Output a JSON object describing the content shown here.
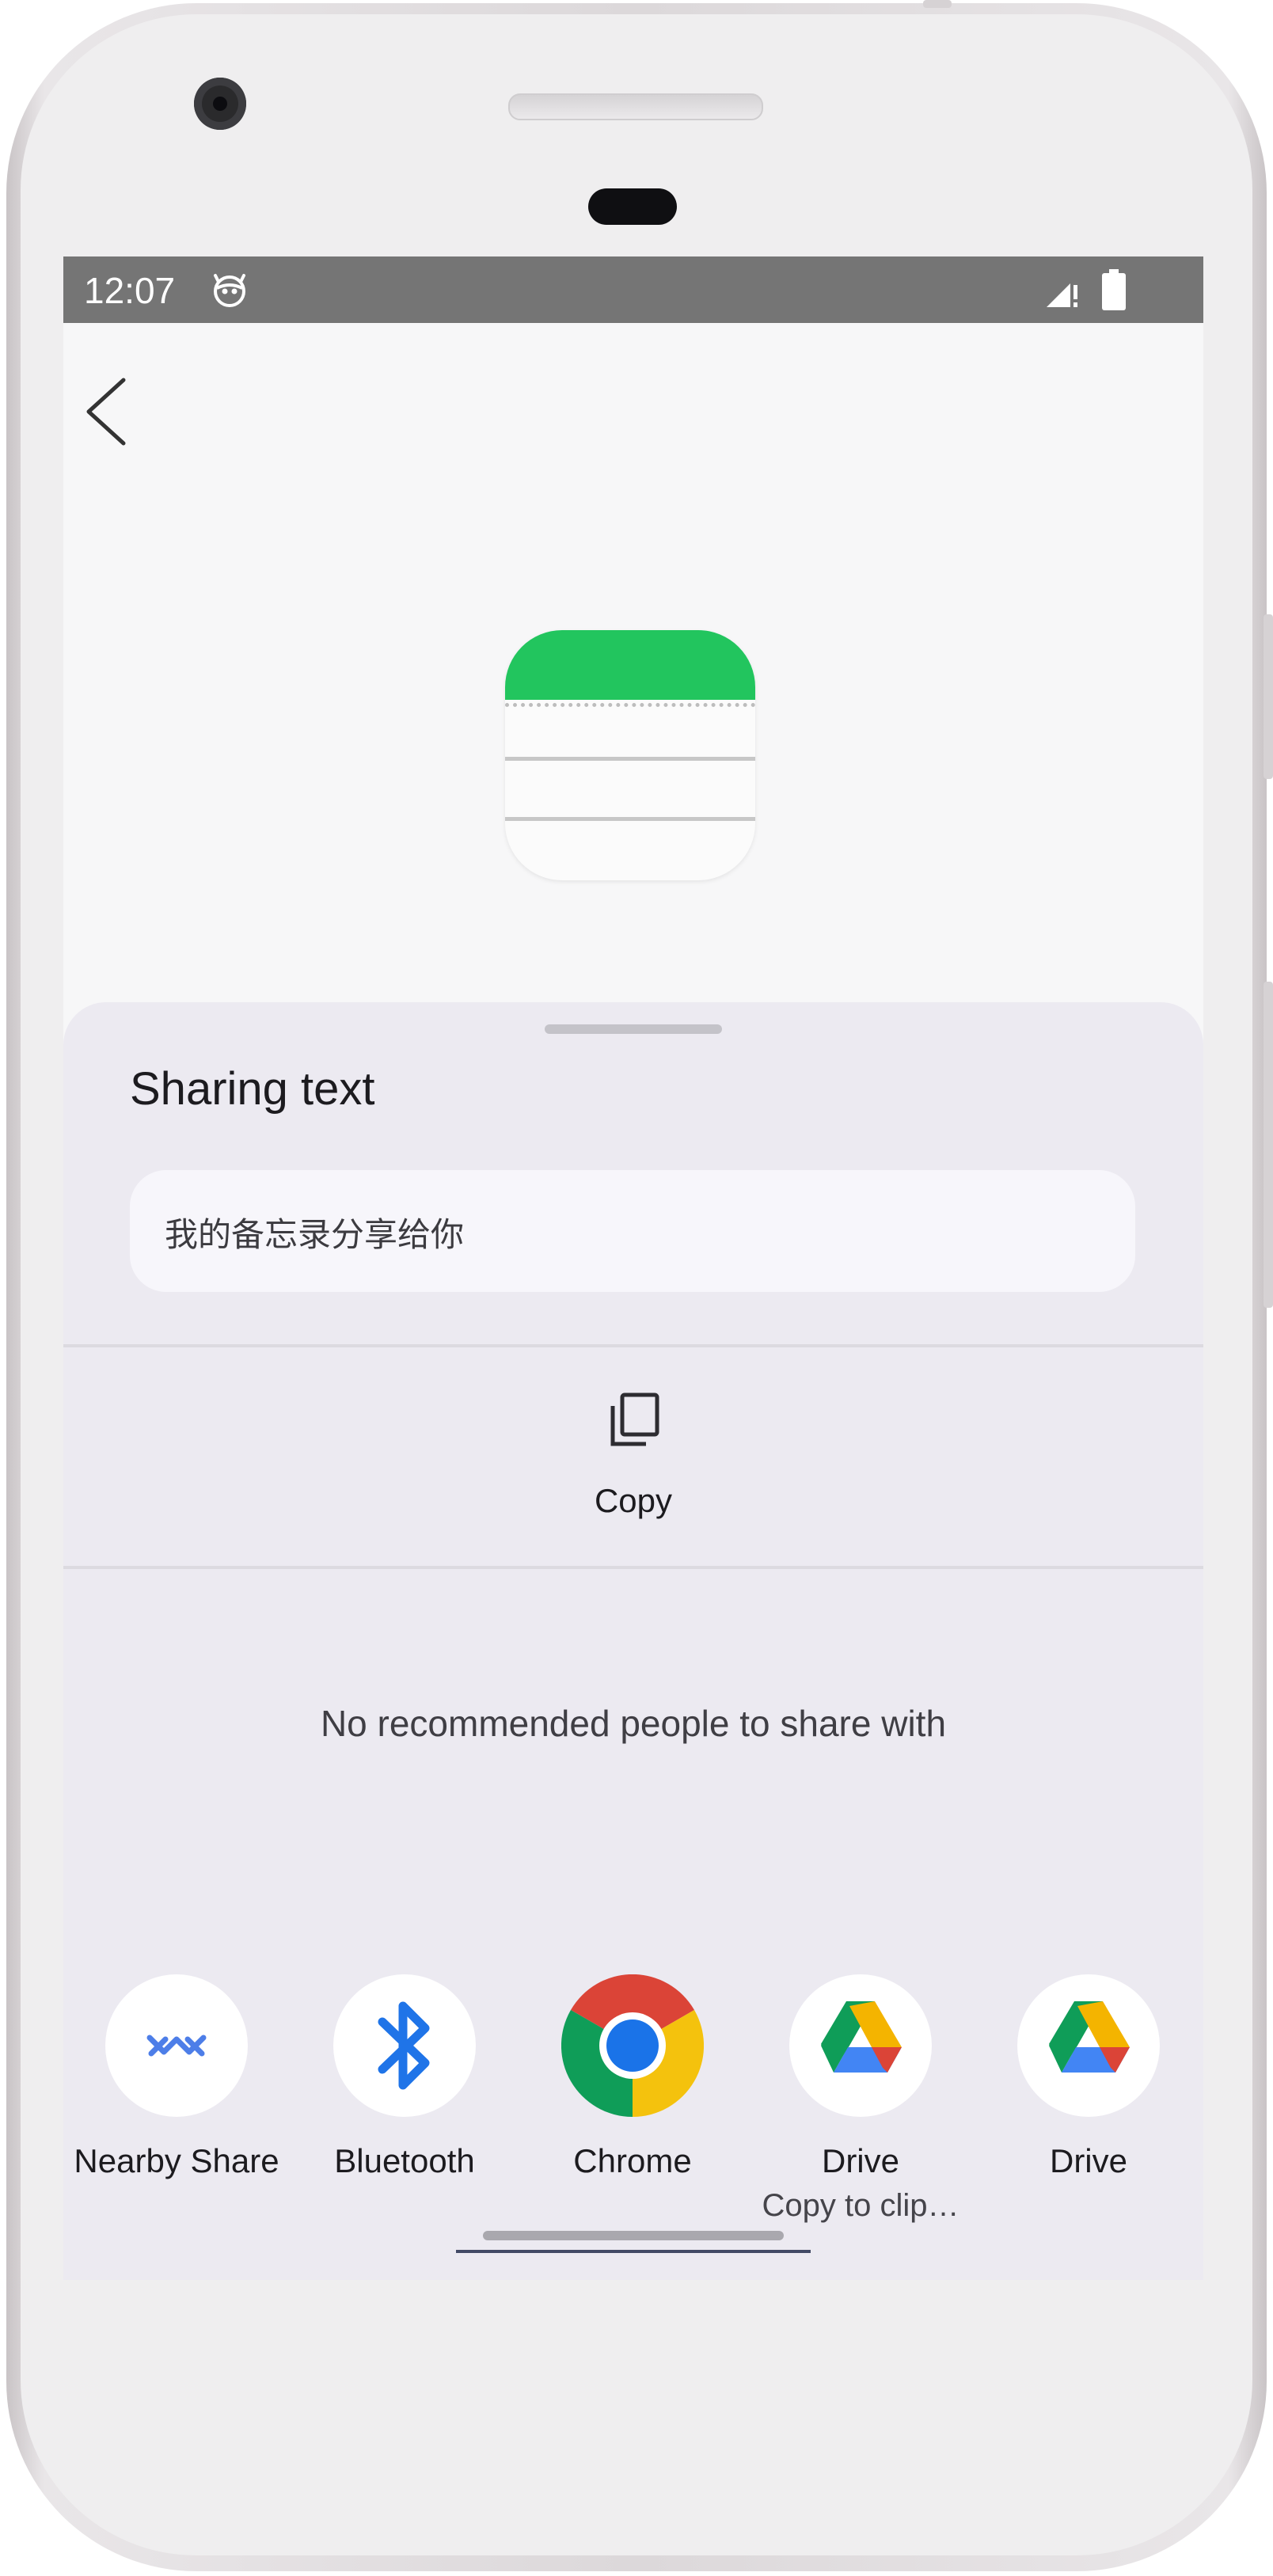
{
  "status_bar": {
    "time": "12:07",
    "background_color": "#757575",
    "icons": [
      "bot-face-icon",
      "signal-icon",
      "battery-icon"
    ]
  },
  "app": {
    "back_icon": "chevron-left-icon",
    "app_icon": "notes-app-icon",
    "accent_color": "#22c55e"
  },
  "share_sheet": {
    "title": "Sharing text",
    "shared_text": "我的备忘录分享给你",
    "copy_label": "Copy",
    "no_recommendations": "No recommended people to share with",
    "targets": [
      {
        "label": "Nearby Share",
        "sublabel": "",
        "icon": "nearby-share-icon"
      },
      {
        "label": "Bluetooth",
        "sublabel": "",
        "icon": "bluetooth-icon"
      },
      {
        "label": "Chrome",
        "sublabel": "",
        "icon": "chrome-icon"
      },
      {
        "label": "Drive",
        "sublabel": "Copy to clip…",
        "icon": "google-drive-icon"
      },
      {
        "label": "Drive",
        "sublabel": "",
        "icon": "google-drive-icon"
      }
    ]
  }
}
